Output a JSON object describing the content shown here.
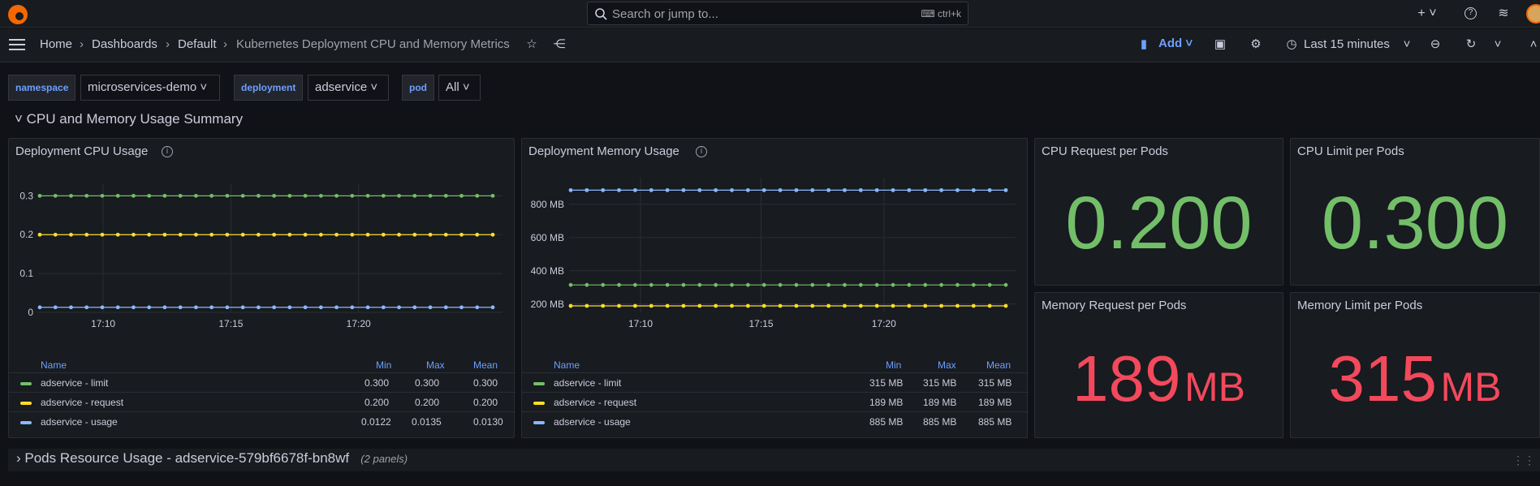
{
  "topbar": {
    "search_placeholder": "Search or jump to...",
    "search_shortcut": "ctrl+k",
    "add_icon": "plus-icon",
    "help_icon": "help-icon",
    "news_icon": "rss-icon"
  },
  "navbar": {
    "breadcrumbs": [
      "Home",
      "Dashboards",
      "Default",
      "Kubernetes Deployment CPU and Memory Metrics"
    ],
    "add_label": "Add",
    "time_range": "Last 15 minutes"
  },
  "variables": [
    {
      "label": "namespace",
      "value": "microservices-demo"
    },
    {
      "label": "deployment",
      "value": "adservice"
    },
    {
      "label": "pod",
      "value": "All"
    }
  ],
  "rows": {
    "summary_title": "CPU and Memory Usage Summary",
    "pods_title": "Pods Resource Usage - adservice-579bf6678f-bn8wf",
    "pods_subtitle": "(2 panels)"
  },
  "panels": {
    "cpu_title": "Deployment CPU Usage",
    "mem_title": "Deployment Memory Usage",
    "stat_cpu_request_title": "CPU Request per Pods",
    "stat_cpu_request_value": "0.200",
    "stat_cpu_limit_title": "CPU Limit per Pods",
    "stat_cpu_limit_value": "0.300",
    "stat_mem_request_title": "Memory Request per Pods",
    "stat_mem_request_value": "189",
    "stat_mem_request_unit": "MB",
    "stat_mem_limit_title": "Memory Limit per Pods",
    "stat_mem_limit_value": "315",
    "stat_mem_limit_unit": "MB"
  },
  "legend_headers": {
    "name": "Name",
    "min": "Min",
    "max": "Max",
    "mean": "Mean"
  },
  "colors": {
    "limit": "#73bf69",
    "request": "#fade2a",
    "usage": "#8ab8ff",
    "stat_green": "#73bf69",
    "stat_red": "#f2495c",
    "accent": "#6e9fff"
  },
  "chart_data": [
    {
      "type": "line",
      "title": "Deployment CPU Usage",
      "x_ticks": [
        "17:10",
        "17:15",
        "17:20"
      ],
      "y_ticks": [
        "0",
        "0.1",
        "0.2",
        "0.3"
      ],
      "ylim": [
        0,
        0.33
      ],
      "points_per_series": 30,
      "series": [
        {
          "name": "adservice - limit",
          "color_key": "limit",
          "value": 0.3,
          "min": "0.300",
          "max": "0.300",
          "mean": "0.300"
        },
        {
          "name": "adservice - request",
          "color_key": "request",
          "value": 0.2,
          "min": "0.200",
          "max": "0.200",
          "mean": "0.200"
        },
        {
          "name": "adservice - usage",
          "color_key": "usage",
          "value": 0.013,
          "min": "0.0122",
          "max": "0.0135",
          "mean": "0.0130"
        }
      ]
    },
    {
      "type": "line",
      "title": "Deployment Memory Usage",
      "x_ticks": [
        "17:10",
        "17:15",
        "17:20"
      ],
      "y_ticks": [
        "200 MB",
        "400 MB",
        "600 MB",
        "800 MB"
      ],
      "ylim": [
        150,
        960
      ],
      "points_per_series": 28,
      "series": [
        {
          "name": "adservice - limit",
          "color_key": "limit",
          "value": 315,
          "min": "315 MB",
          "max": "315 MB",
          "mean": "315 MB"
        },
        {
          "name": "adservice - request",
          "color_key": "request",
          "value": 189,
          "min": "189 MB",
          "max": "189 MB",
          "mean": "189 MB"
        },
        {
          "name": "adservice - usage",
          "color_key": "usage",
          "value": 885,
          "min": "885 MB",
          "max": "885 MB",
          "mean": "885 MB"
        }
      ]
    }
  ]
}
